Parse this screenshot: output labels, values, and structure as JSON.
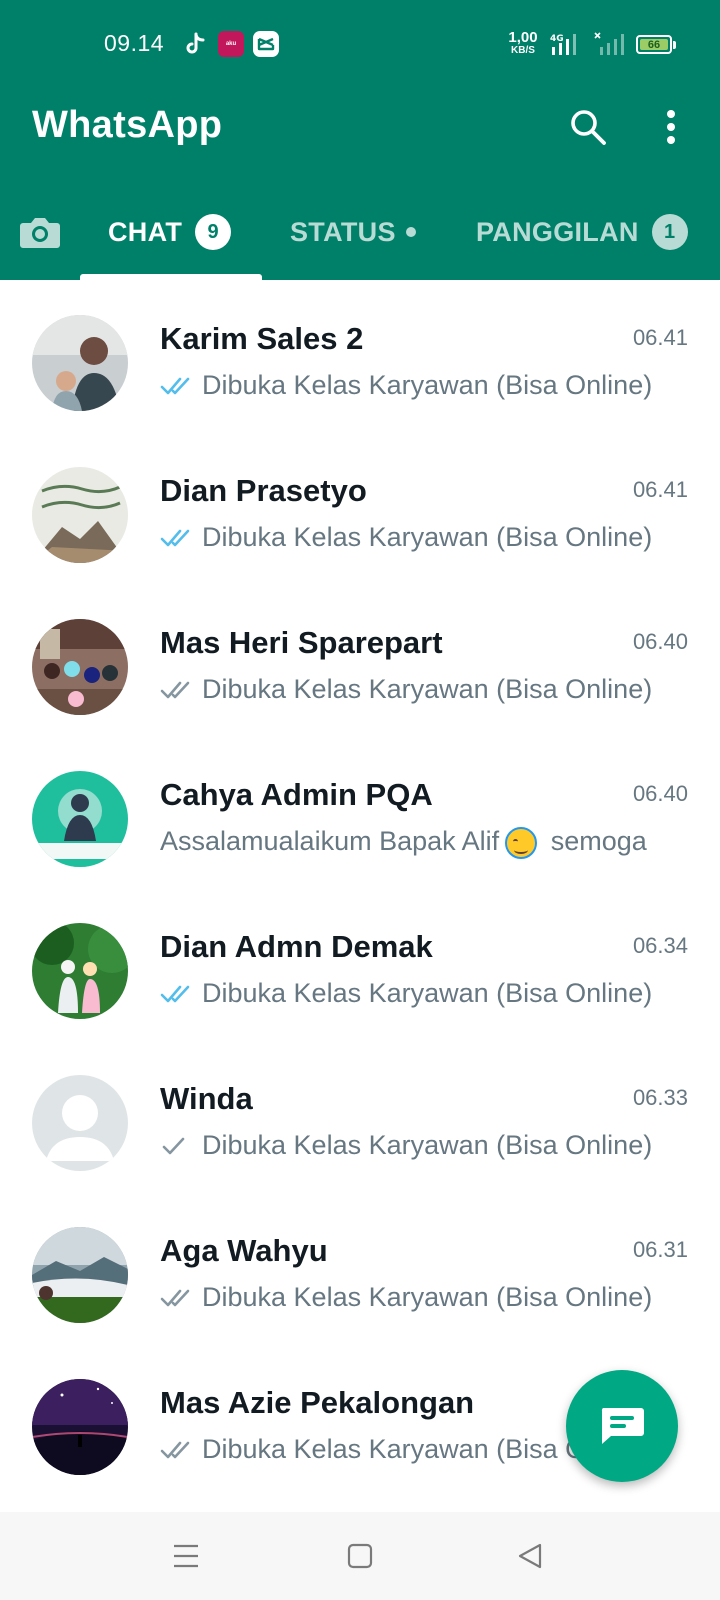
{
  "status_bar": {
    "time": "09.14",
    "net_speed_value": "1,00",
    "net_speed_unit": "KB/S",
    "network_type": "4G",
    "battery_level": "66",
    "notification_icons": [
      "tiktok-icon",
      "akulaku-icon",
      "capcut-icon"
    ]
  },
  "app": {
    "title": "WhatsApp"
  },
  "tabs": {
    "chat_label": "CHAT",
    "chat_badge": "9",
    "status_label": "STATUS",
    "calls_label": "PANGGILAN",
    "calls_badge": "1"
  },
  "chats": [
    {
      "name": "Karim Sales 2",
      "time": "06.41",
      "receipt": "read",
      "preview": "Dibuka Kelas Karyawan (Bisa Online)"
    },
    {
      "name": "Dian Prasetyo",
      "time": "06.41",
      "receipt": "read",
      "preview": "Dibuka Kelas Karyawan (Bisa Online)"
    },
    {
      "name": "Mas Heri Sparepart",
      "time": "06.40",
      "receipt": "delivered",
      "preview": "Dibuka Kelas Karyawan (Bisa Online)"
    },
    {
      "name": "Cahya Admin PQA",
      "time": "06.40",
      "receipt": "none",
      "preview_before_emoji": "Assalamualaikum Bapak Alif",
      "preview_after_emoji": "semoga"
    },
    {
      "name": "Dian Admn Demak",
      "time": "06.34",
      "receipt": "read",
      "preview": "Dibuka Kelas Karyawan (Bisa Online)"
    },
    {
      "name": "Winda",
      "time": "06.33",
      "receipt": "sent",
      "preview": "Dibuka Kelas Karyawan (Bisa Online)"
    },
    {
      "name": "Aga Wahyu",
      "time": "06.31",
      "receipt": "delivered",
      "preview": "Dibuka Kelas Karyawan (Bisa Online)"
    },
    {
      "name": "Mas Azie Pekalongan",
      "time": "",
      "receipt": "delivered",
      "preview": "Dibuka Kelas Karyawan (Bisa Online)"
    }
  ],
  "colors": {
    "header": "#008069",
    "fab": "#00a884",
    "read_tick": "#53bdeb",
    "muted_text": "#667781",
    "name_text": "#111b21"
  },
  "icons": {
    "search": "search-icon",
    "menu": "more-vert-icon",
    "camera": "camera-icon",
    "fab": "new-chat-icon",
    "nav": [
      "recents-menu-icon",
      "home-square-icon",
      "back-triangle-icon"
    ]
  }
}
